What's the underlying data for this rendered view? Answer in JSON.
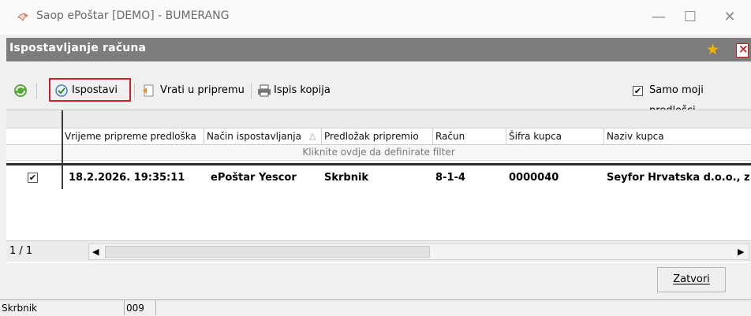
{
  "window": {
    "title": "Saop ePoštar [DEMO] - BUMERANG",
    "minimize_symbol": "—",
    "maximize_symbol": "☐",
    "close_symbol": "✕"
  },
  "header": {
    "title": "Ispostavljanje računa",
    "favorite_icon": "star-icon",
    "close_doc_icon": "close-document-icon"
  },
  "toolbar": {
    "refresh_icon": "refresh-icon",
    "issue_label": "Ispostavi",
    "return_label": "Vrati u pripremu",
    "print_label": "Ispis kopija",
    "only_mine_label": "Samo moji predlošci",
    "only_mine_checked": true
  },
  "grid": {
    "columns": [
      "Vrijeme pripreme predloška",
      "Način ispostavljanja",
      "Predložak pripremio",
      "Račun",
      "Šifra kupca",
      "Naziv kupca"
    ],
    "sort_indicator": "△",
    "filter_hint": "Kliknite ovdje da definirate filter",
    "rows": [
      {
        "checked": true,
        "time": "18.2.2026. 19:35:11",
        "method": "ePoštar Yescor",
        "prepared_by": "Skrbnik",
        "invoice": "8-1-4",
        "customer_code": "0000040",
        "customer_name": "Seyfor Hrvatska d.o.o., z"
      }
    ],
    "pager": "1 / 1"
  },
  "footer": {
    "close_label": "Zatvori"
  },
  "statusbar": {
    "user": "Skrbnik",
    "code": "009"
  },
  "colors": {
    "header_bg": "#7d7d7d",
    "highlight_border": "#d0202a",
    "star": "#f0b400"
  }
}
